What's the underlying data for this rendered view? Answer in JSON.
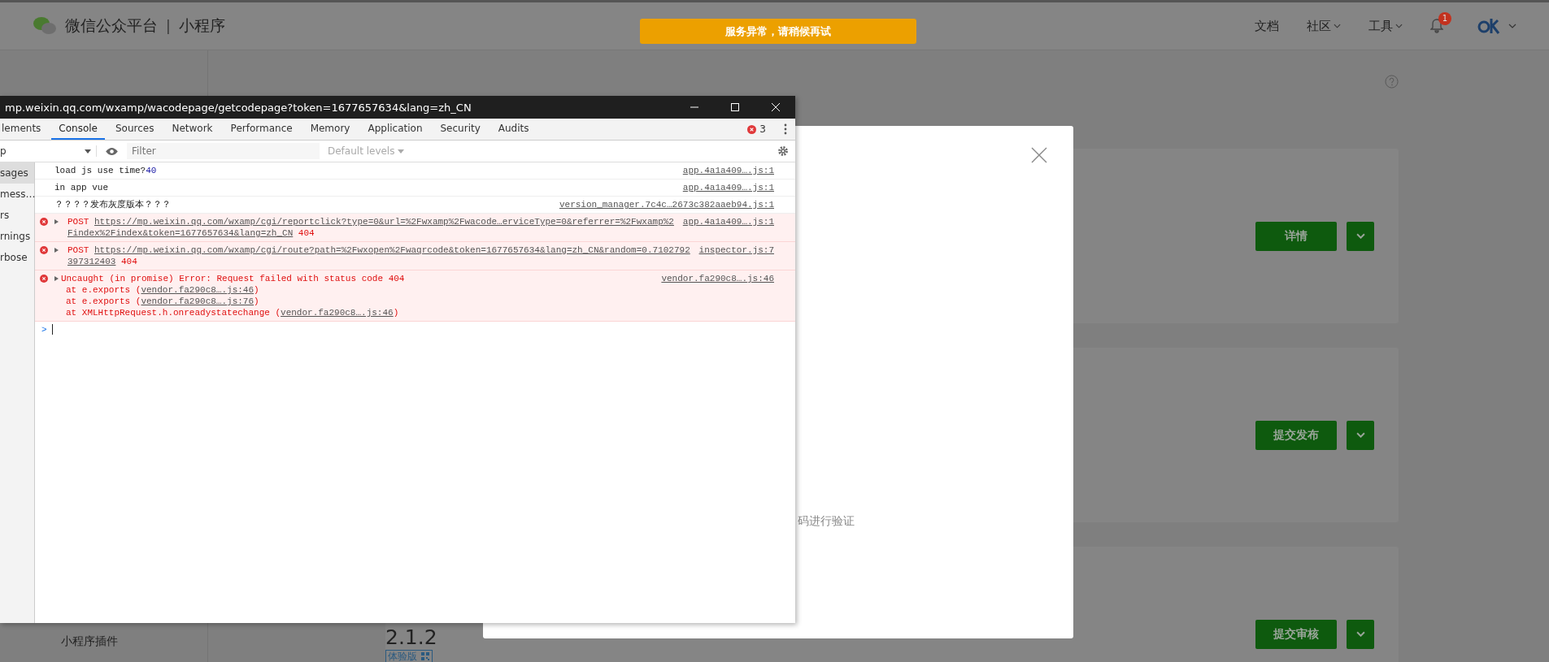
{
  "header": {
    "brand": "微信公众平台",
    "divider": "|",
    "product": "小程序",
    "notice": "服务异常，请稍候再试",
    "nav": [
      {
        "label": "文档",
        "caret": false
      },
      {
        "label": "社区",
        "caret": true
      },
      {
        "label": "工具",
        "caret": true
      }
    ],
    "notification_badge": "1"
  },
  "sidebar": {
    "items": [
      "小程序插件"
    ]
  },
  "page": {
    "cards": [
      {
        "button": "详情"
      },
      {
        "button": "提交发布"
      },
      {
        "button": "提交审核"
      }
    ],
    "version": "2.1.2",
    "version_tag": "体验版"
  },
  "modal": {
    "text": "码进行验证"
  },
  "devtools": {
    "title": "mp.weixin.qq.com/wxamp/wacodepage/getcodepage?token=1677657634&lang=zh_CN",
    "tabs": [
      {
        "label": "lements",
        "selected": false
      },
      {
        "label": "Console",
        "selected": true
      },
      {
        "label": "Sources",
        "selected": false
      },
      {
        "label": "Network",
        "selected": false
      },
      {
        "label": "Performance",
        "selected": false
      },
      {
        "label": "Memory",
        "selected": false
      },
      {
        "label": "Application",
        "selected": false
      },
      {
        "label": "Security",
        "selected": false
      },
      {
        "label": "Audits",
        "selected": false
      }
    ],
    "error_count": "3",
    "context": "p",
    "filter_placeholder": "Filter",
    "levels": "Default levels",
    "sidebar": [
      {
        "label": "sages",
        "selected": true
      },
      {
        "label": "mess…",
        "selected": false
      },
      {
        "label": "rs",
        "selected": false
      },
      {
        "label": "rnings",
        "selected": false
      },
      {
        "label": "rbose",
        "selected": false
      }
    ],
    "messages": [
      {
        "kind": "log",
        "text": "load js use time?",
        "value": "40",
        "source": "app.4a1a409….js:1"
      },
      {
        "kind": "log",
        "text": "in app vue",
        "source": "app.4a1a409….js:1"
      },
      {
        "kind": "log",
        "text": "？？？？发布灰度版本？？？",
        "source": "version_manager.7c4c…2673c382aaeb94.js:1"
      },
      {
        "kind": "request",
        "method": "POST",
        "url": "https://mp.weixin.qq.com/wxamp/cgi/reportclick?type=0&url=%2Fwxamp%2Fwacode…erviceType=0&referrer=%2Fwxamp%2Findex%2Findex&token=1677657634&lang=zh_CN",
        "status": "404",
        "source": "app.4a1a409….js:1"
      },
      {
        "kind": "request",
        "method": "POST",
        "url": "https://mp.weixin.qq.com/wxamp/cgi/route?path=%2Fwxopen%2Fwaqrcode&token=1677657634&lang=zh_CN&random=0.7102792397312403",
        "status": "404",
        "source": "inspector.js:7"
      },
      {
        "kind": "exception",
        "text": "Uncaught (in promise) Error: Request failed with status code 404",
        "source": "vendor.fa290c8….js:46",
        "stack": [
          {
            "prefix": "at e.exports (",
            "link": "vendor.fa290c8….js:46",
            "suffix": ")"
          },
          {
            "prefix": "at e.exports (",
            "link": "vendor.fa290c8….js:76",
            "suffix": ")"
          },
          {
            "prefix": "at XMLHttpRequest.h.onreadystatechange (",
            "link": "vendor.fa290c8….js:46",
            "suffix": ")"
          }
        ]
      }
    ],
    "prompt": ">"
  }
}
